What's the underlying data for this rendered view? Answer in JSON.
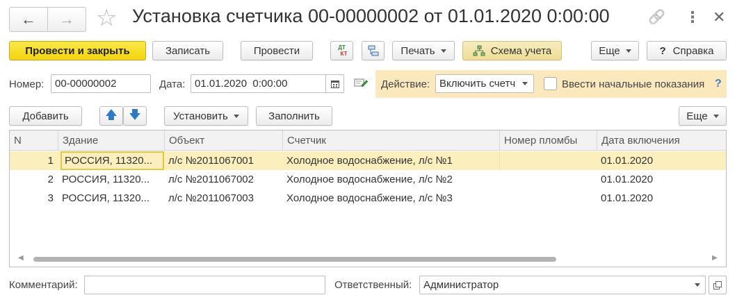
{
  "header": {
    "title": "Установка счетчика 00-00000002 от 01.01.2020 0:00:00",
    "back_icon": "←",
    "forward_icon": "→",
    "star_icon": "☆",
    "link_icon": "🔗",
    "more_icon": "⋮",
    "close_icon": "✕"
  },
  "toolbar": {
    "post_close": "Провести и закрыть",
    "save": "Записать",
    "post": "Провести",
    "dtkt_top": "ДТ",
    "dtkt_bottom": "КТ",
    "print": "Печать",
    "scheme": "Схема учета",
    "more": "Еще",
    "help_icon": "?",
    "help": "Справка"
  },
  "form": {
    "number_label": "Номер:",
    "number_value": "00-00000002",
    "date_label": "Дата:",
    "date_value": "01.01.2020  0:00:00",
    "action_label": "Действие:",
    "action_value": "Включить счетч",
    "initial_readings_label": "Ввести начальные показания",
    "help_mark": "?"
  },
  "table_toolbar": {
    "add": "Добавить",
    "up_icon": "🡅",
    "down_icon": "🡇",
    "install": "Установить",
    "fill": "Заполнить",
    "more": "Еще"
  },
  "table": {
    "columns": [
      "N",
      "Здание",
      "Объект",
      "Счетчик",
      "Номер пломбы",
      "Дата включения"
    ],
    "rows": [
      {
        "n": "1",
        "building": "РОССИЯ, 11320...",
        "object": "л/с №2011067001",
        "meter": "Холодное водоснабжение, л/с №1",
        "seal": "",
        "date": "01.01.2020"
      },
      {
        "n": "2",
        "building": "РОССИЯ, 11320...",
        "object": "л/с №2011067002",
        "meter": "Холодное водоснабжение, л/с №2",
        "seal": "",
        "date": "01.01.2020"
      },
      {
        "n": "3",
        "building": "РОССИЯ, 11320...",
        "object": "л/с №2011067003",
        "meter": "Холодное водоснабжение, л/с №3",
        "seal": "",
        "date": "01.01.2020"
      }
    ]
  },
  "footer": {
    "comment_label": "Комментарий:",
    "comment_value": "",
    "responsible_label": "Ответственный:",
    "responsible_value": "Администратор"
  },
  "colors": {
    "primary_button": "#f5d81c",
    "selected_row": "#fcefbe",
    "action_panel": "#fbe9bd",
    "accent_blue": "#3b7fc4"
  }
}
